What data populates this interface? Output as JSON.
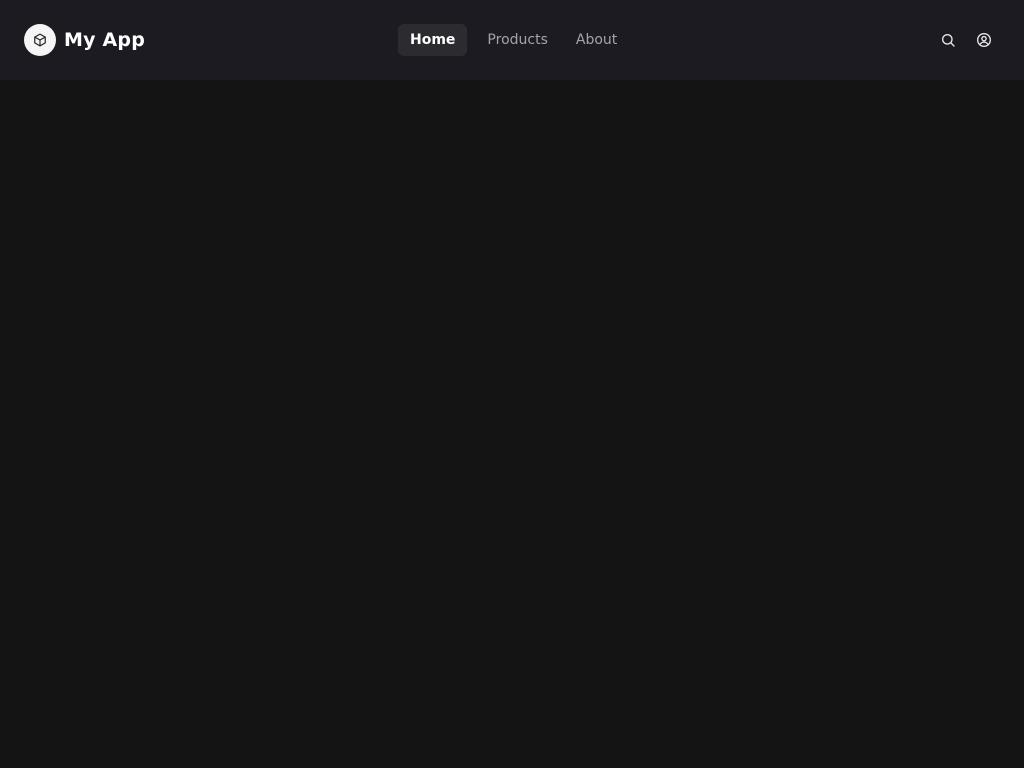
{
  "app": {
    "title": "My App",
    "logo_icon": "cube-icon"
  },
  "nav": {
    "items": [
      {
        "label": "Home",
        "active": true
      },
      {
        "label": "Products",
        "active": false
      },
      {
        "label": "About",
        "active": false
      }
    ]
  },
  "actions": {
    "search_icon": "search-icon",
    "account_icon": "user-circle-icon"
  },
  "colors": {
    "navbar_bg": "#1c1b22",
    "page_bg": "#141414",
    "active_tab_bg": "#2b2b30",
    "text_primary": "#ffffff",
    "text_muted": "#a3a3a8"
  }
}
